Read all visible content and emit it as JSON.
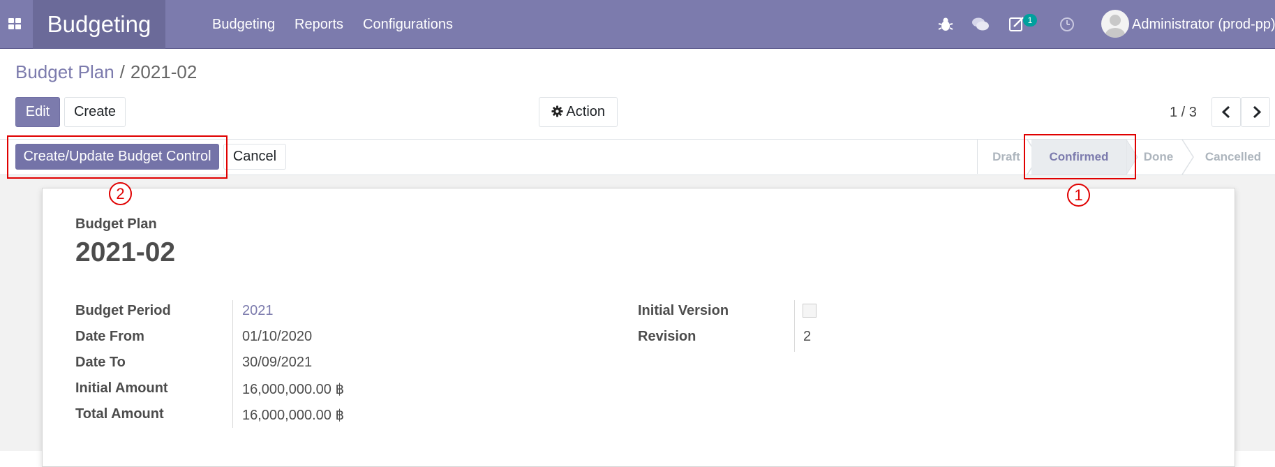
{
  "navbar": {
    "icons": [
      "apps-icon",
      "bug-icon",
      "chat-icon",
      "activity-icon",
      "clock-icon"
    ],
    "brand": "Budgeting",
    "menu": [
      "Budgeting",
      "Reports",
      "Configurations"
    ],
    "activity_count": "1",
    "user": "Administrator (prod-pp)"
  },
  "breadcrumb": {
    "parent": "Budget Plan",
    "separator": "/",
    "current": "2021-02"
  },
  "toolbar": {
    "edit": "Edit",
    "create": "Create",
    "action": "Action",
    "action_icon": "gear-icon"
  },
  "pager": {
    "value": "1 / 3",
    "prev_icon": "chevron-left-icon",
    "next_icon": "chevron-right-icon"
  },
  "header_buttons": {
    "primary": "Create/Update Budget Control",
    "cancel": "Cancel"
  },
  "statusbar": {
    "stages": [
      "Draft",
      "Confirmed",
      "Done",
      "Cancelled"
    ],
    "active": "Confirmed"
  },
  "form": {
    "label": "Budget Plan",
    "name": "2021-02",
    "left_fields": [
      {
        "label": "Budget Period",
        "value": "2021"
      },
      {
        "label": "Date From",
        "value": "01/10/2020"
      },
      {
        "label": "Date To",
        "value": "30/09/2021"
      },
      {
        "label": "Initial Amount",
        "value": "16,000,000.00 ฿"
      },
      {
        "label": "Total Amount",
        "value": "16,000,000.00 ฿"
      }
    ],
    "right_fields": [
      {
        "label": "Initial Version",
        "value": ""
      },
      {
        "label": "Revision",
        "value": "2"
      }
    ]
  },
  "annotations": {
    "one": "1",
    "two": "2"
  },
  "colors": {
    "brand": "#7c7bad",
    "brand_dark": "#6b6a99",
    "badge": "#00a09d",
    "annotation": "#e00000"
  }
}
